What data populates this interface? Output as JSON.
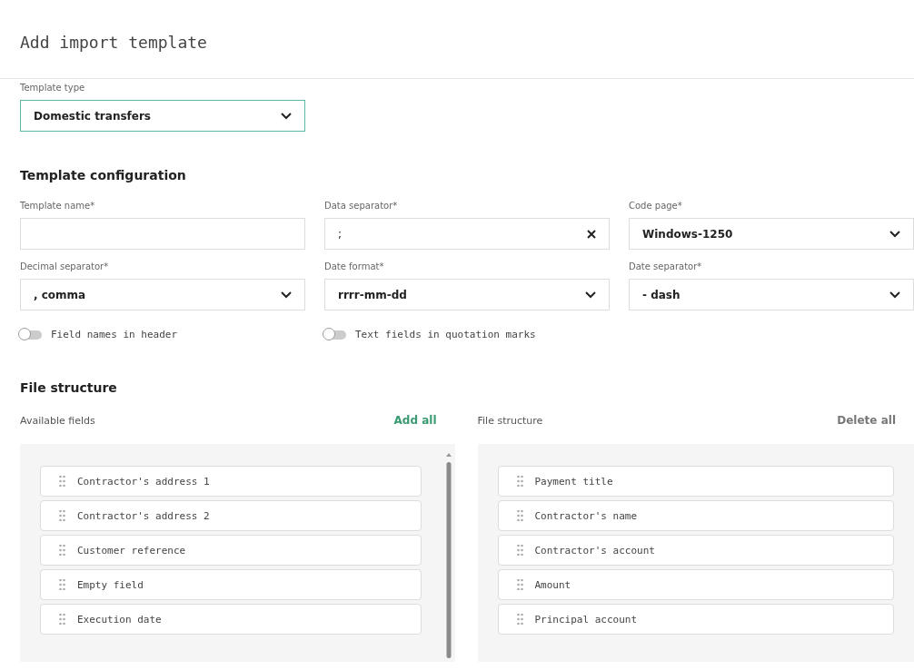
{
  "title": "Add import template",
  "template_type": {
    "label": "Template type",
    "value": "Domestic transfers",
    "focused": true
  },
  "config": {
    "heading": "Template configuration",
    "fields": [
      {
        "label": "Template name*",
        "kind": "text"
      },
      {
        "label": "Data separator*",
        "kind": "clearable",
        "value": ";"
      },
      {
        "label": "Code page*",
        "kind": "select",
        "value": "Windows-1250"
      },
      {
        "label": "Decimal separator*",
        "kind": "select",
        "value": ", comma"
      },
      {
        "label": "Date format*",
        "kind": "select",
        "value": "rrrr-mm-dd"
      },
      {
        "label": "Date separator*",
        "kind": "select",
        "value": "- dash"
      }
    ],
    "toggles": [
      {
        "label": "Field names in header",
        "on": false
      },
      {
        "label": "Text fields in quotation marks",
        "on": false
      }
    ]
  },
  "file_structure": {
    "heading": "File structure",
    "available": {
      "label": "Available fields",
      "action": "Add all",
      "items": [
        "Contractor's address 1",
        "Contractor's address 2",
        "Customer reference",
        "Empty field",
        "Execution date"
      ]
    },
    "selected": {
      "label": "File structure",
      "action": "Delete all",
      "items": [
        "Payment title",
        "Contractor's name",
        "Contractor's account",
        "Amount",
        "Principal account"
      ]
    }
  }
}
